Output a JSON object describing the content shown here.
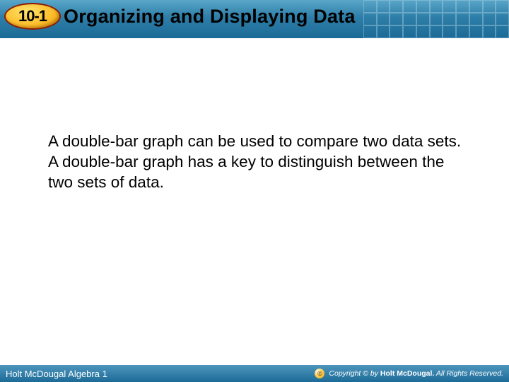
{
  "header": {
    "section_number": "10-1",
    "title": "Organizing and Displaying Data"
  },
  "body": {
    "paragraph": "A double-bar graph can be used to compare two data sets. A double-bar graph has a key to distinguish between the two sets of data."
  },
  "footer": {
    "left": "Holt McDougal Algebra 1",
    "copyright_symbol": "©",
    "copyright_prefix": "Copyright © by ",
    "copyright_brand": "Holt McDougal.",
    "copyright_suffix": " All Rights Reserved."
  }
}
